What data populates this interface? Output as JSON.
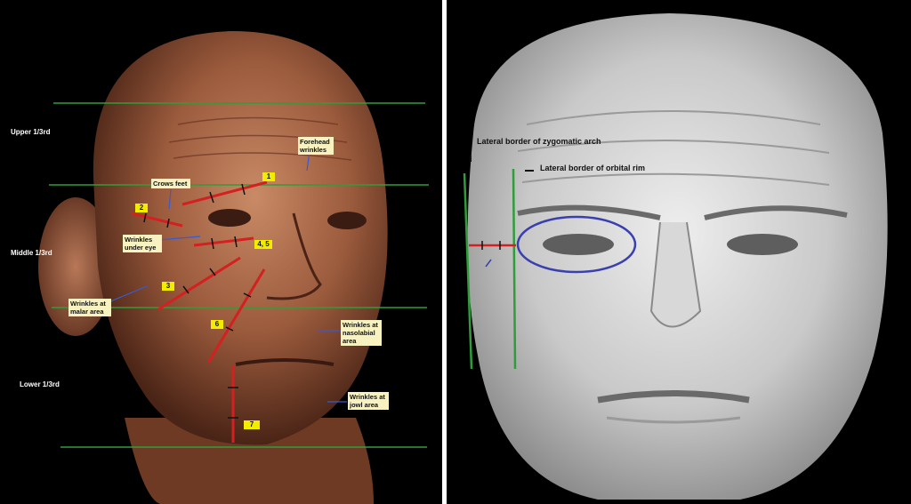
{
  "left": {
    "zones": {
      "upper": "Upper 1/3rd",
      "middle": "Middle 1/3rd",
      "lower": "Lower 1/3rd"
    },
    "annotations": {
      "forehead": "Forehead wrinkles",
      "crows_feet": "Crows feet",
      "under_eye": "Wrinkles under eye",
      "malar": "Wrinkles at malar area",
      "nasolabial": "Wrinkles at nasolabial area",
      "jowl": "Wrinkles at jowl area"
    },
    "numbers": [
      "1",
      "2",
      "3",
      "4, 5",
      "6",
      "7"
    ]
  },
  "right": {
    "labels": {
      "zygomatic": "Lateral border of zygomatic arch",
      "orbital": "Lateral border of orbital rim"
    }
  },
  "colors": {
    "green_line": "#2f9e3a",
    "red_line": "#d42020",
    "blue_ellipse": "#3a3fb0",
    "label_bg": "#f7f2c0",
    "number_bg": "#f2ec00"
  }
}
